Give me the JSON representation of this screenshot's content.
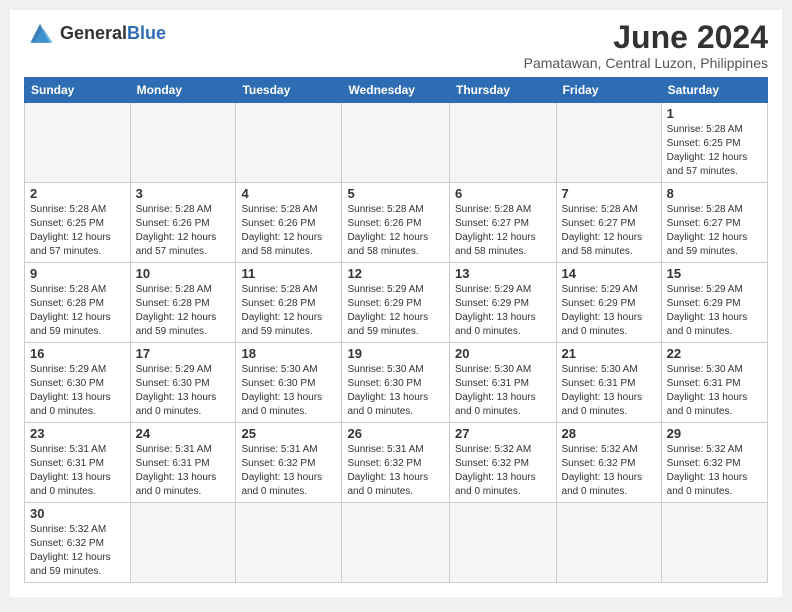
{
  "header": {
    "logo_general": "General",
    "logo_blue": "Blue",
    "month_title": "June 2024",
    "subtitle": "Pamatawan, Central Luzon, Philippines"
  },
  "weekdays": [
    "Sunday",
    "Monday",
    "Tuesday",
    "Wednesday",
    "Thursday",
    "Friday",
    "Saturday"
  ],
  "weeks": [
    [
      {
        "day": "",
        "info": ""
      },
      {
        "day": "",
        "info": ""
      },
      {
        "day": "",
        "info": ""
      },
      {
        "day": "",
        "info": ""
      },
      {
        "day": "",
        "info": ""
      },
      {
        "day": "",
        "info": ""
      },
      {
        "day": "1",
        "info": "Sunrise: 5:28 AM\nSunset: 6:25 PM\nDaylight: 12 hours\nand 57 minutes."
      }
    ],
    [
      {
        "day": "2",
        "info": "Sunrise: 5:28 AM\nSunset: 6:25 PM\nDaylight: 12 hours\nand 57 minutes."
      },
      {
        "day": "3",
        "info": "Sunrise: 5:28 AM\nSunset: 6:26 PM\nDaylight: 12 hours\nand 57 minutes."
      },
      {
        "day": "4",
        "info": "Sunrise: 5:28 AM\nSunset: 6:26 PM\nDaylight: 12 hours\nand 58 minutes."
      },
      {
        "day": "5",
        "info": "Sunrise: 5:28 AM\nSunset: 6:26 PM\nDaylight: 12 hours\nand 58 minutes."
      },
      {
        "day": "6",
        "info": "Sunrise: 5:28 AM\nSunset: 6:27 PM\nDaylight: 12 hours\nand 58 minutes."
      },
      {
        "day": "7",
        "info": "Sunrise: 5:28 AM\nSunset: 6:27 PM\nDaylight: 12 hours\nand 58 minutes."
      },
      {
        "day": "8",
        "info": "Sunrise: 5:28 AM\nSunset: 6:27 PM\nDaylight: 12 hours\nand 59 minutes."
      }
    ],
    [
      {
        "day": "9",
        "info": "Sunrise: 5:28 AM\nSunset: 6:28 PM\nDaylight: 12 hours\nand 59 minutes."
      },
      {
        "day": "10",
        "info": "Sunrise: 5:28 AM\nSunset: 6:28 PM\nDaylight: 12 hours\nand 59 minutes."
      },
      {
        "day": "11",
        "info": "Sunrise: 5:28 AM\nSunset: 6:28 PM\nDaylight: 12 hours\nand 59 minutes."
      },
      {
        "day": "12",
        "info": "Sunrise: 5:29 AM\nSunset: 6:29 PM\nDaylight: 12 hours\nand 59 minutes."
      },
      {
        "day": "13",
        "info": "Sunrise: 5:29 AM\nSunset: 6:29 PM\nDaylight: 13 hours\nand 0 minutes."
      },
      {
        "day": "14",
        "info": "Sunrise: 5:29 AM\nSunset: 6:29 PM\nDaylight: 13 hours\nand 0 minutes."
      },
      {
        "day": "15",
        "info": "Sunrise: 5:29 AM\nSunset: 6:29 PM\nDaylight: 13 hours\nand 0 minutes."
      }
    ],
    [
      {
        "day": "16",
        "info": "Sunrise: 5:29 AM\nSunset: 6:30 PM\nDaylight: 13 hours\nand 0 minutes."
      },
      {
        "day": "17",
        "info": "Sunrise: 5:29 AM\nSunset: 6:30 PM\nDaylight: 13 hours\nand 0 minutes."
      },
      {
        "day": "18",
        "info": "Sunrise: 5:30 AM\nSunset: 6:30 PM\nDaylight: 13 hours\nand 0 minutes."
      },
      {
        "day": "19",
        "info": "Sunrise: 5:30 AM\nSunset: 6:30 PM\nDaylight: 13 hours\nand 0 minutes."
      },
      {
        "day": "20",
        "info": "Sunrise: 5:30 AM\nSunset: 6:31 PM\nDaylight: 13 hours\nand 0 minutes."
      },
      {
        "day": "21",
        "info": "Sunrise: 5:30 AM\nSunset: 6:31 PM\nDaylight: 13 hours\nand 0 minutes."
      },
      {
        "day": "22",
        "info": "Sunrise: 5:30 AM\nSunset: 6:31 PM\nDaylight: 13 hours\nand 0 minutes."
      }
    ],
    [
      {
        "day": "23",
        "info": "Sunrise: 5:31 AM\nSunset: 6:31 PM\nDaylight: 13 hours\nand 0 minutes."
      },
      {
        "day": "24",
        "info": "Sunrise: 5:31 AM\nSunset: 6:31 PM\nDaylight: 13 hours\nand 0 minutes."
      },
      {
        "day": "25",
        "info": "Sunrise: 5:31 AM\nSunset: 6:32 PM\nDaylight: 13 hours\nand 0 minutes."
      },
      {
        "day": "26",
        "info": "Sunrise: 5:31 AM\nSunset: 6:32 PM\nDaylight: 13 hours\nand 0 minutes."
      },
      {
        "day": "27",
        "info": "Sunrise: 5:32 AM\nSunset: 6:32 PM\nDaylight: 13 hours\nand 0 minutes."
      },
      {
        "day": "28",
        "info": "Sunrise: 5:32 AM\nSunset: 6:32 PM\nDaylight: 13 hours\nand 0 minutes."
      },
      {
        "day": "29",
        "info": "Sunrise: 5:32 AM\nSunset: 6:32 PM\nDaylight: 13 hours\nand 0 minutes."
      }
    ],
    [
      {
        "day": "30",
        "info": "Sunrise: 5:32 AM\nSunset: 6:32 PM\nDaylight: 12 hours\nand 59 minutes."
      },
      {
        "day": "",
        "info": ""
      },
      {
        "day": "",
        "info": ""
      },
      {
        "day": "",
        "info": ""
      },
      {
        "day": "",
        "info": ""
      },
      {
        "day": "",
        "info": ""
      },
      {
        "day": "",
        "info": ""
      }
    ]
  ]
}
